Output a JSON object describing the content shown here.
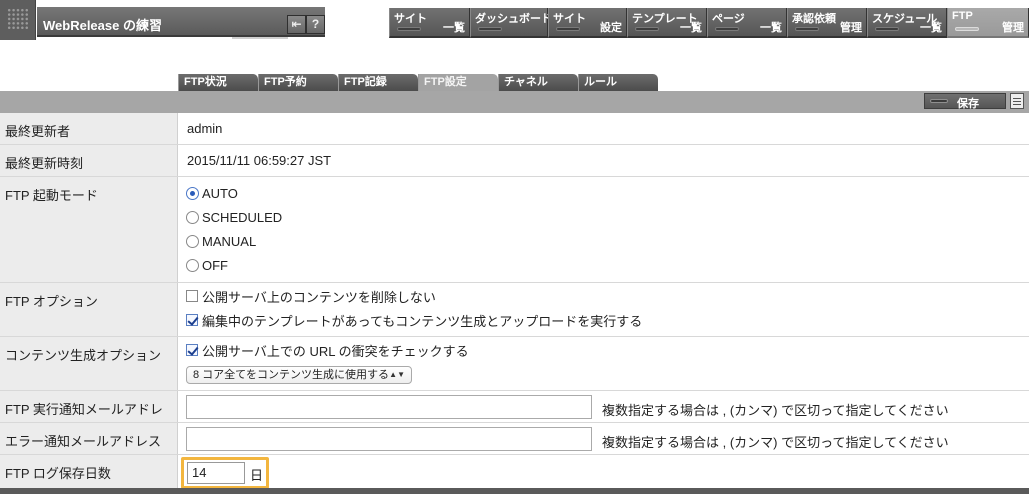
{
  "app": {
    "title": "WebRelease の練習",
    "back_icon": "back-arrow-icon",
    "help_label": "?"
  },
  "topnav": [
    {
      "top": "サイト",
      "bottom": "一覧",
      "active": false
    },
    {
      "top": "ダッシュボード",
      "bottom": "",
      "active": false
    },
    {
      "top": "サイト",
      "bottom": "設定",
      "active": false
    },
    {
      "top": "テンプレート",
      "bottom": "一覧",
      "active": false
    },
    {
      "top": "ページ",
      "bottom": "一覧",
      "active": false
    },
    {
      "top": "承認依頼",
      "bottom": "管理",
      "active": false
    },
    {
      "top": "スケジュール",
      "bottom": "一覧",
      "active": false
    },
    {
      "top": "FTP",
      "bottom": "管理",
      "active": true
    }
  ],
  "subtabs": [
    {
      "label": "FTP状況",
      "active": false
    },
    {
      "label": "FTP予約",
      "active": false
    },
    {
      "label": "FTP記録",
      "active": false
    },
    {
      "label": "FTP設定",
      "active": true
    },
    {
      "label": "チャネル",
      "active": false
    },
    {
      "label": "ルール",
      "active": false
    }
  ],
  "toolbar": {
    "save_label": "保存"
  },
  "form": {
    "last_updated_by": {
      "label": "最終更新者",
      "value": "admin"
    },
    "last_updated_at": {
      "label": "最終更新時刻",
      "value": "2015/11/11 06:59:27 JST"
    },
    "startup_mode": {
      "label": "FTP 起動モード",
      "options": [
        "AUTO",
        "SCHEDULED",
        "MANUAL",
        "OFF"
      ],
      "selected": "AUTO"
    },
    "ftp_options": {
      "label": "FTP オプション",
      "items": [
        {
          "text": "公開サーバ上のコンテンツを削除しない",
          "checked": false
        },
        {
          "text": "編集中のテンプレートがあってもコンテンツ生成とアップロードを実行する",
          "checked": true
        }
      ]
    },
    "content_options": {
      "label": "コンテンツ生成オプション",
      "check_text": "公開サーバ上での URL の衝突をチェックする",
      "checked": true,
      "select_value": "8 コア全てをコンテンツ生成に使用する"
    },
    "exec_mail": {
      "label": "FTP 実行通知メールアドレス",
      "value": "",
      "hint": "複数指定する場合は , (カンマ) で区切って指定してください"
    },
    "error_mail": {
      "label": "エラー通知メールアドレス",
      "value": "",
      "hint": "複数指定する場合は , (カンマ) で区切って指定してください"
    },
    "log_days": {
      "label": "FTP ログ保存日数",
      "value": "14",
      "unit": "日"
    }
  }
}
